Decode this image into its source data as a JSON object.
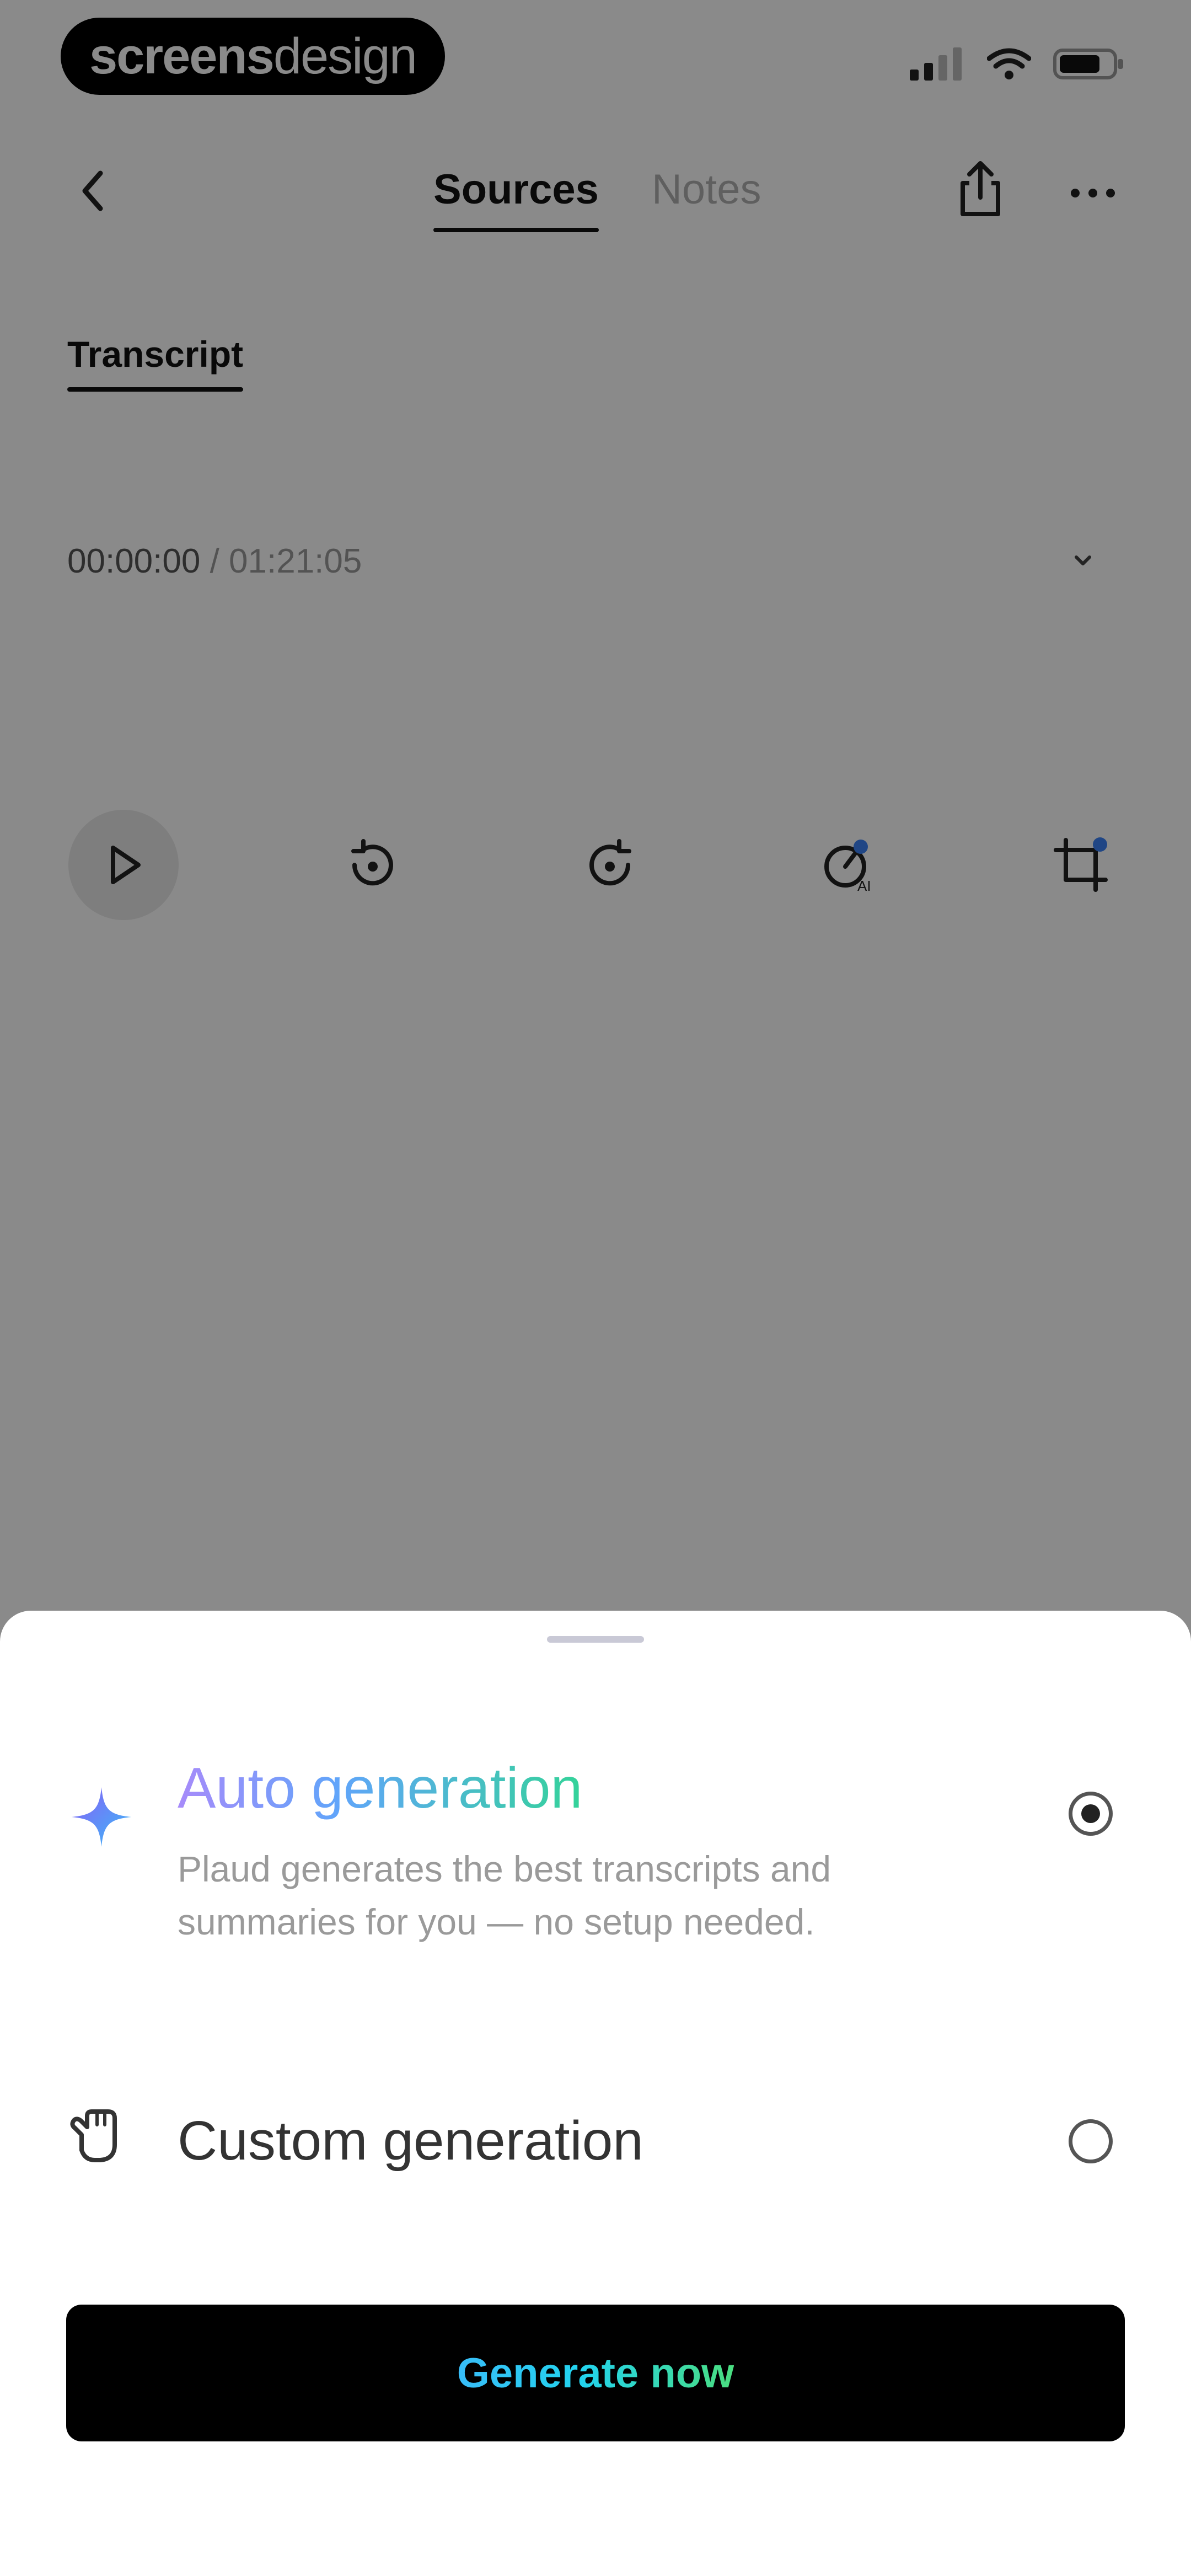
{
  "status_bar": {
    "brand_bold": "screens",
    "brand_light": "design",
    "icons": [
      "signal-icon",
      "wifi-icon",
      "battery-icon"
    ]
  },
  "header": {
    "back_icon": "chevron-left-icon",
    "tabs": [
      {
        "label": "Sources",
        "active": true
      },
      {
        "label": "Notes",
        "active": false
      }
    ],
    "share_icon": "share-icon",
    "more_icon": "more-horizontal-icon"
  },
  "subtabs": [
    {
      "label": "Transcript",
      "active": true
    }
  ],
  "player": {
    "time_current": "00:00:00",
    "time_separator": " / ",
    "time_total": "01:21:05",
    "controls": [
      "play-icon",
      "rewind-icon",
      "forward-icon",
      "speed-icon",
      "crop-icon"
    ]
  },
  "sheet": {
    "options": [
      {
        "title": "Auto generation",
        "description": "Plaud generates the best transcripts and summaries for you — no setup needed.",
        "icon": "sparkle-icon",
        "selected": true
      },
      {
        "title": "Custom generation",
        "icon": "hand-icon",
        "selected": false
      }
    ],
    "primary_button": "Generate now"
  },
  "colors": {
    "overlay": "#000000",
    "button_bg": "#000000",
    "gradient_start": "#a78bfa",
    "gradient_mid": "#60a5fa",
    "gradient_end": "#34d399"
  }
}
